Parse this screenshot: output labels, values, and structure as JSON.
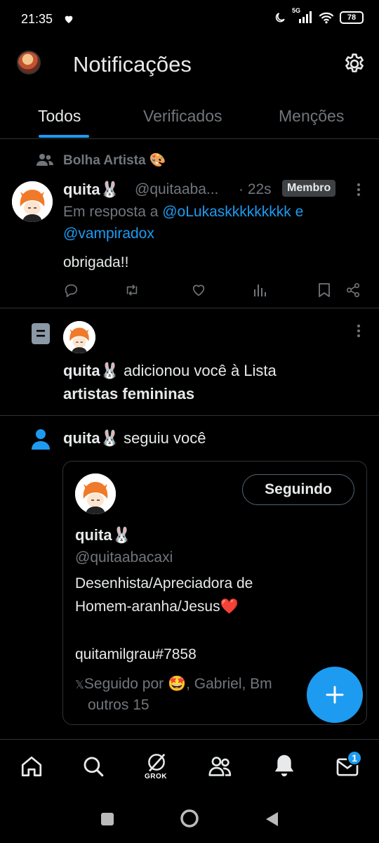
{
  "status_bar": {
    "time": "21:35",
    "battery": "78",
    "network": "5G"
  },
  "header": {
    "title": "Notificações"
  },
  "tabs": [
    {
      "label": "Todos",
      "active": true
    },
    {
      "label": "Verificados",
      "active": false
    },
    {
      "label": "Menções",
      "active": false
    }
  ],
  "notifications": {
    "community_reply": {
      "community": "Bolha Artista 🎨",
      "author_name": "quita🐰",
      "handle": "@quitaaba...",
      "time": "· 22s",
      "badge": "Membro",
      "reply_prefix": "Em resposta a ",
      "reply_user1": "@oLukaskkkkkkkkk",
      "reply_and": " e",
      "reply_user2": "@vampiradox",
      "text": "obrigada!!"
    },
    "list_add": {
      "actor": "quita🐰",
      "action": " adicionou você à Lista",
      "list_name": "artistas femininas"
    },
    "follow": {
      "actor": "quita🐰",
      "action": " seguiu você",
      "card": {
        "button_label": "Seguindo",
        "name": "quita🐰",
        "handle": "@quitaabacaxi",
        "bio_line1": "Desenhista/Apreciadora de",
        "bio_line2": "Homem-aranha/Jesus❤️",
        "bio_line3": "quitamilgrau#7858",
        "followed_by": "Seguido por 🤩, Gabriel, Bm",
        "followed_by_more": "outros 15"
      }
    }
  },
  "bottom_nav": {
    "grok_label": "GROK",
    "messages_badge": "1"
  },
  "colors": {
    "accent": "#1d9bf0",
    "background": "#000000",
    "muted": "#71767b"
  }
}
